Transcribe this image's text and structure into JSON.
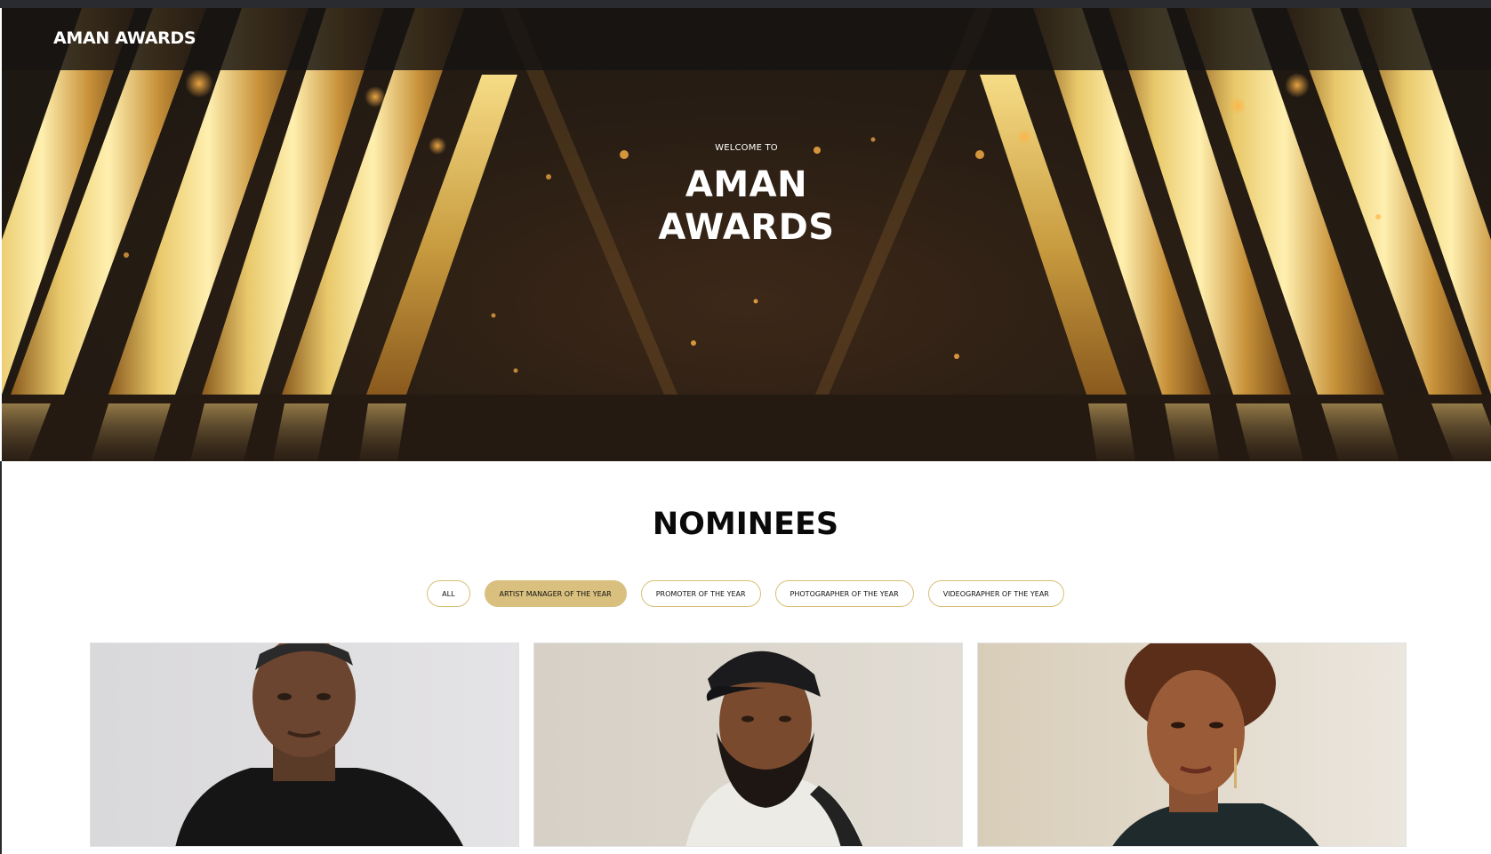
{
  "navbar": {
    "brand": "AMAN AWARDS"
  },
  "hero": {
    "welcome": "WELCOME TO",
    "title_line1": "AMAN",
    "title_line2": "AWARDS"
  },
  "nominees": {
    "title": "NOMINEES",
    "filters": [
      {
        "label": "ALL",
        "active": false
      },
      {
        "label": "ARTIST MANAGER OF THE YEAR",
        "active": true
      },
      {
        "label": "PROMOTER OF THE YEAR",
        "active": false
      },
      {
        "label": "PHOTOGRAPHER OF THE YEAR",
        "active": false
      },
      {
        "label": "VIDEOGRAPHER OF THE YEAR",
        "active": false
      }
    ]
  },
  "colors": {
    "accent_gold": "#d9c07f",
    "hero_dark": "#1e1812",
    "text_dark": "#0a0a0a"
  }
}
